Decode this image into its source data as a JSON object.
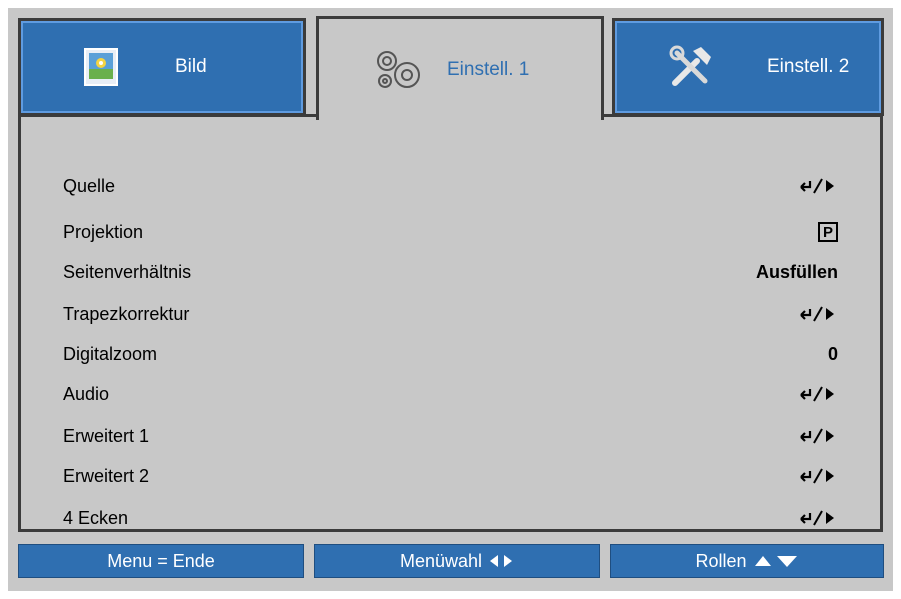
{
  "tabs": [
    {
      "label": "Bild",
      "icon": "picture-icon"
    },
    {
      "label": "Einstell. 1",
      "icon": "gears-icon"
    },
    {
      "label": "Einstell. 2",
      "icon": "tools-icon"
    }
  ],
  "menu": {
    "items": [
      {
        "label": "Quelle",
        "value_type": "enter-arrow"
      },
      {
        "label": "Projektion",
        "value": "P"
      },
      {
        "label": "Seitenverhältnis",
        "value": "Ausfüllen"
      },
      {
        "label": "Trapezkorrektur",
        "value_type": "enter-arrow"
      },
      {
        "label": "Digitalzoom",
        "value": "0"
      },
      {
        "label": "Audio",
        "value_type": "enter-arrow"
      },
      {
        "label": "Erweitert 1",
        "value_type": "enter-arrow"
      },
      {
        "label": "Erweitert 2",
        "value_type": "enter-arrow"
      },
      {
        "label": "4 Ecken",
        "value_type": "enter-arrow"
      }
    ]
  },
  "footer": {
    "exit": "Menu = Ende",
    "select": "Menüwahl",
    "scroll": "Rollen"
  },
  "colors": {
    "accent": "#2f6fb1",
    "panel": "#c8c8c8",
    "border": "#3b3b3b"
  }
}
